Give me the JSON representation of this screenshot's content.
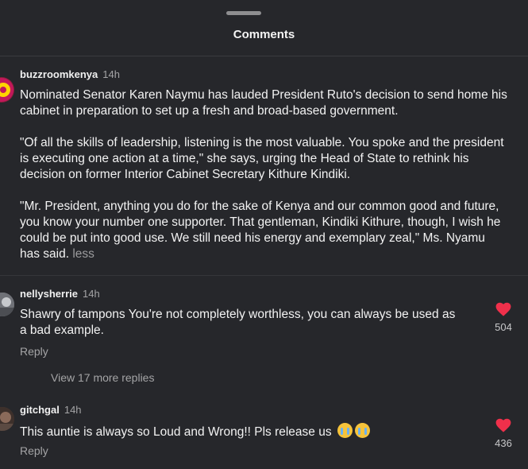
{
  "sheet": {
    "title": "Comments"
  },
  "colors": {
    "background": "#26272b",
    "heart": "#f0304b",
    "muted": "#a4a4a6"
  },
  "comments": [
    {
      "username": "buzzroomkenya",
      "time": "14h",
      "paragraphs": [
        "Nominated Senator Karen Naymu has lauded President Ruto's decision to send home his cabinet in preparation to set up a fresh and broad-based government.",
        "\"Of all the skills of leadership, listening is the most valuable. You spoke and the president is executing one action at a time,\" she says, urging the Head of State to rethink his decision on former Interior Cabinet Secretary Kithure Kindiki.",
        "\"Mr. President, anything you do for the sake of Kenya and our common good and future, you know your number one supporter. That gentleman, Kindiki Kithure, though, I wish he could be put into good use. We still need his energy and exemplary zeal,\" Ms. Nyamu has said."
      ],
      "less_label": "less"
    },
    {
      "username": "nellysherrie",
      "time": "14h",
      "text": "Shawry of tampons You're not completely worthless, you can always be used as a bad example.",
      "reply_label": "Reply",
      "like_icon": "heart-icon",
      "likes": "504",
      "more_replies": "View 17 more replies"
    },
    {
      "username": "gitchgal",
      "time": "14h",
      "text": "This auntie is always so Loud and Wrong!! Pls release us",
      "emojis": [
        "crying-face-emoji",
        "crying-face-emoji"
      ],
      "reply_label": "Reply",
      "like_icon": "heart-icon",
      "likes": "436"
    }
  ]
}
